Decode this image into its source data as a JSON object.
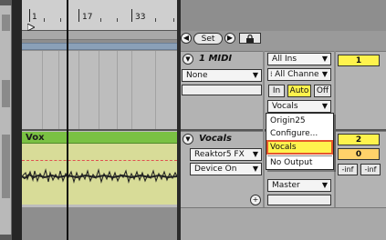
{
  "ruler": {
    "marks": [
      "1",
      "17",
      "33"
    ]
  },
  "topbar": {
    "set_label": "Set",
    "back_glyph": "◀",
    "fwd_glyph": "▶"
  },
  "tracks": [
    {
      "name": "1 MIDI",
      "input_device": "None",
      "input_type": "All Ins",
      "input_channel": "All Channe",
      "monitor": [
        "In",
        "Auto",
        "Off"
      ],
      "output": "Vocals",
      "number": "1"
    },
    {
      "name": "Vocals",
      "clip_name": "Vox",
      "input_device": "Reaktor5 FX",
      "input_type": "Device On",
      "output": "Master",
      "number": "2",
      "volume": "0",
      "meters": [
        "-inf",
        "-inf"
      ]
    }
  ],
  "output_menu": {
    "items": [
      "Origin25",
      "Configure...",
      "Vocals",
      "No Output"
    ],
    "selected": "Vocals"
  },
  "colors": {
    "clip_header": "#7ac143",
    "clip_body": "#d8dc98",
    "highlight": "#fff34d",
    "menu_selection_outline": "#e4572e"
  }
}
